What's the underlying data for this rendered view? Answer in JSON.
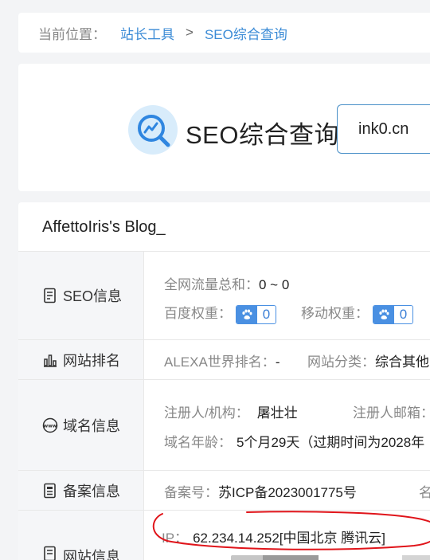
{
  "breadcrumb": {
    "label": "当前位置：",
    "home": "站长工具",
    "separator": ">",
    "current": "SEO综合查询"
  },
  "search": {
    "title": "SEO综合查询",
    "query": "ink0.cn",
    "logo_icon": "chart-magnifier-icon"
  },
  "site": {
    "title": "AffettoIris's Blog_"
  },
  "rows": {
    "seo": {
      "label": "SEO信息",
      "icon": "document-icon",
      "traffic_label": "全网流量总和：",
      "traffic_value": "0 ~ 0",
      "baidu_label": "百度权重：",
      "baidu_value": "0",
      "mobile_label": "移动权重：",
      "mobile_value": "0"
    },
    "rank": {
      "label": "网站排名",
      "icon": "bar-chart-icon",
      "alexa_label": "ALEXA世界排名：",
      "alexa_value": "-",
      "category_label": "网站分类：",
      "category_value": "综合其他"
    },
    "domain": {
      "label": "域名信息",
      "icon": "www-icon",
      "registrant_label": "注册人/机构：",
      "registrant_value": "屠壮壮",
      "email_label": "注册人邮箱：",
      "age_label": "域名年龄：",
      "age_value": "5个月29天（过期时间为2028年"
    },
    "icp": {
      "label": "备案信息",
      "icon": "record-icon",
      "number_label": "备案号：",
      "number_value": "苏ICP备2023001775号",
      "name_label": "名"
    },
    "server": {
      "label": "网站信息",
      "icon": "server-icon",
      "ip_label": "IP：",
      "ip_value": "62.234.14.252[中国北京 腾讯云]"
    }
  },
  "colors": {
    "accent": "#3b8bd6",
    "annotation": "#e0141a",
    "badge": "#4a90e2"
  }
}
